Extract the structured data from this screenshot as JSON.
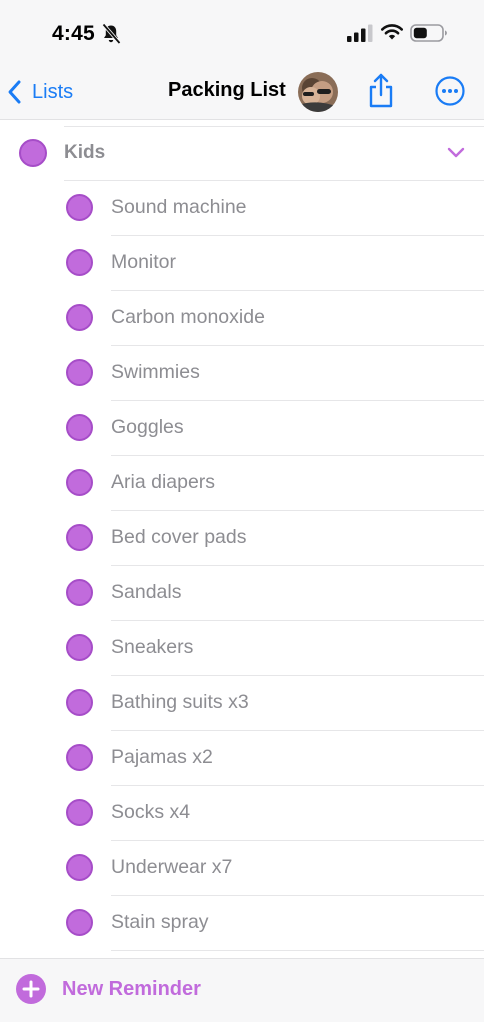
{
  "colors": {
    "accent": "#c16bdc",
    "accent_border": "#a64dc8",
    "link_blue": "#1a7cf5",
    "secondary_text": "#8d8d92"
  },
  "status_bar": {
    "time": "4:45",
    "icons": [
      "bell-slash-icon",
      "signal-icon",
      "wifi-icon",
      "battery-icon"
    ]
  },
  "nav": {
    "back_label": "Lists",
    "title": "Packing List",
    "buttons": [
      "share-icon",
      "ellipsis-circle-icon"
    ]
  },
  "section": {
    "title": "Kids",
    "expanded": true
  },
  "items": [
    {
      "label": "Sound machine"
    },
    {
      "label": "Monitor"
    },
    {
      "label": "Carbon monoxide"
    },
    {
      "label": "Swimmies"
    },
    {
      "label": "Goggles"
    },
    {
      "label": "Aria diapers"
    },
    {
      "label": "Bed cover pads"
    },
    {
      "label": "Sandals"
    },
    {
      "label": "Sneakers"
    },
    {
      "label": "Bathing suits x3"
    },
    {
      "label": "Pajamas x2"
    },
    {
      "label": "Socks x4"
    },
    {
      "label": "Underwear x7"
    },
    {
      "label": "Stain spray"
    }
  ],
  "bottom": {
    "new_reminder_label": "New Reminder"
  }
}
